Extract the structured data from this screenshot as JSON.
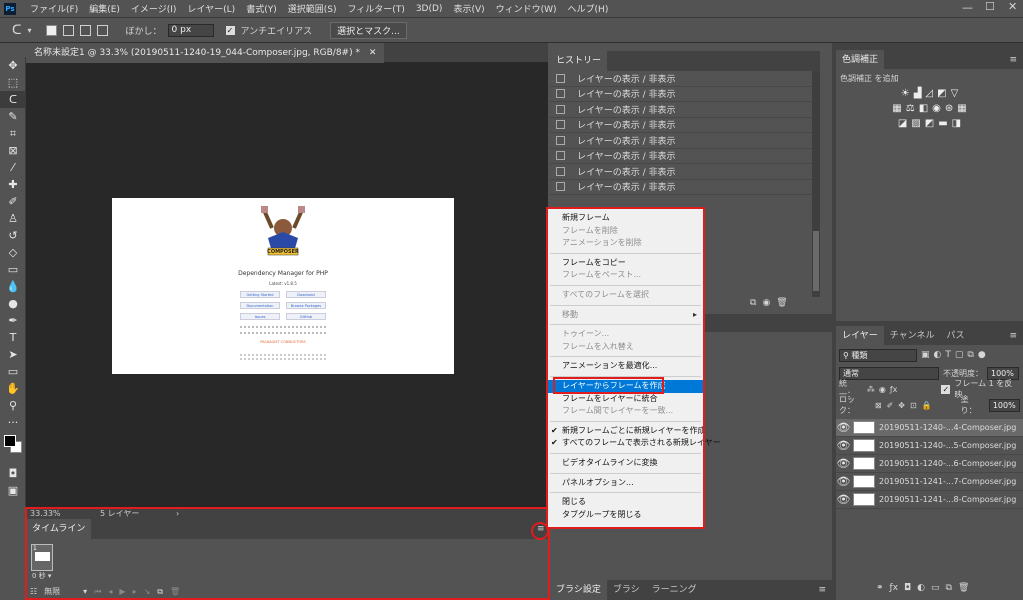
{
  "menubar": {
    "app_icon": "Ps",
    "items": [
      "ファイル(F)",
      "編集(E)",
      "イメージ(I)",
      "レイヤー(L)",
      "書式(Y)",
      "選択範囲(S)",
      "フィルター(T)",
      "3D(D)",
      "表示(V)",
      "ウィンドウ(W)",
      "ヘルプ(H)"
    ]
  },
  "options": {
    "feather_label": "ぼかし：",
    "feather_value": "0 px",
    "antialias_label": "アンチエイリアス",
    "select_mask": "選択とマスク..."
  },
  "document": {
    "tab_title": "名称未設定1 @ 33.3% (20190511-1240-19_044-Composer.jpg, RGB/8#) *",
    "zoom": "33.33%",
    "layer_count": "5 レイヤー"
  },
  "composer_page": {
    "logo_word": "COMPOSER",
    "subtitle": "Dependency Manager for PHP",
    "version": "Latest: v1.8.5",
    "buttons": [
      "Getting Started",
      "Download",
      "Documentation",
      "Browse Packages",
      "Issues",
      "GitHub"
    ],
    "sponsor": "PACKAGIST CONDUCTORS"
  },
  "timeline": {
    "title": "タイムライン",
    "frame_number": "1",
    "frame_delay": "0 秒",
    "loop": "無限"
  },
  "history": {
    "title": "ヒストリー",
    "items": [
      "レイヤーの表示 / 非表示",
      "レイヤーの表示 / 非表示",
      "レイヤーの表示 / 非表示",
      "レイヤーの表示 / 非表示",
      "レイヤーの表示 / 非表示",
      "レイヤーの表示 / 非表示",
      "レイヤーの表示 / 非表示",
      "レイヤーの表示 / 非表示"
    ]
  },
  "context_menu": {
    "new_frame": "新規フレーム",
    "delete_frame": "フレームを削除",
    "delete_animation": "アニメーションを削除",
    "copy_frame": "フレームをコピー",
    "paste_frame": "フレームをペースト...",
    "select_all": "すべてのフレームを選択",
    "move": "移動",
    "tween": "トゥイーン...",
    "reverse": "フレームを入れ替え",
    "optimize": "アニメーションを最適化...",
    "make_from_layers": "レイヤーからフレームを作成",
    "flatten": "フレームをレイヤーに統合",
    "match_layer": "フレーム間でレイヤーを一致...",
    "new_layer_each": "新規フレームごとに新規レイヤーを作成",
    "new_layers_visible": "すべてのフレームで表示される新規レイヤー",
    "convert_video": "ビデオタイムラインに変換",
    "panel_options": "パネルオプション...",
    "close": "閉じる",
    "close_group": "タブグループを閉じる"
  },
  "brush_panel": {
    "tabs": [
      "ブラシ設定",
      "ブラシ",
      "ラーニング"
    ]
  },
  "adjustments": {
    "title": "色調補正",
    "subtitle": "色調補正 を追加"
  },
  "layers_panel": {
    "tabs": [
      "レイヤー",
      "チャンネル",
      "パス"
    ],
    "kind": "種類",
    "blend_mode": "通常",
    "opacity_label": "不透明度：",
    "opacity": "100%",
    "unify_label": "統一：",
    "propagate": "フレーム 1 を反映",
    "lock_label": "ロック：",
    "fill_label": "塗り：",
    "fill": "100%",
    "layers": [
      "20190511-1240-...4-Composer.jpg",
      "20190511-1240-...5-Composer.jpg",
      "20190511-1240-...6-Composer.jpg",
      "20190511-1241-...7-Composer.jpg",
      "20190511-1241-...8-Composer.jpg"
    ]
  },
  "colors": {
    "accent": "#0078d7",
    "highlight_red": "#e01c1c"
  }
}
